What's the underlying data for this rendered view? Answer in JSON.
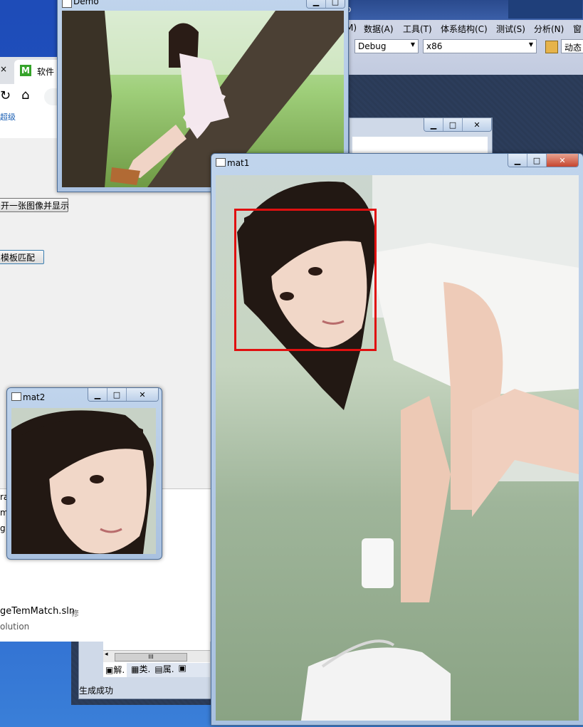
{
  "vs": {
    "menu": [
      "M)",
      "数据(A)",
      "工具(T)",
      "体系结构(C)",
      "测试(S)",
      "分析(N)",
      "窗"
    ],
    "title_tail": "o",
    "config_combo": "Debug",
    "platform_combo": "x86",
    "dynamic_label": "动态",
    "status_text": "生成成功",
    "solution_tabs": [
      "解.",
      "类.",
      "属.",
      ""
    ],
    "solution_file": "geTemMatch.sln",
    "solution_file_suffix": "修",
    "solution_sub": "olution",
    "side_snippets": [
      "ra",
      "m",
      "g"
    ],
    "scroll_thumb": "III"
  },
  "browser": {
    "tab_label": "软件",
    "tab_icon_letter": "M",
    "bookmark_text": "超级"
  },
  "app": {
    "open_button": "开一张图像并显示",
    "match_button": "模板匹配"
  },
  "windows": {
    "demo_title": "Demo",
    "mat1_title": "mat1",
    "mat2_title": "mat2"
  },
  "colors": {
    "match_rect": "#e01010",
    "win_frame": "#a9c1e0"
  }
}
